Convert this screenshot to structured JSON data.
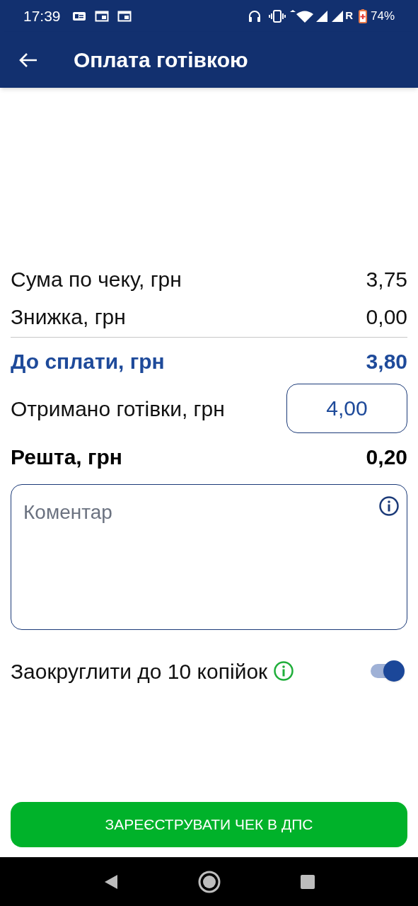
{
  "status_bar": {
    "time": "17:39",
    "roaming": "R",
    "battery": "74%"
  },
  "app_bar": {
    "title": "Оплата готівкою"
  },
  "summary": [
    {
      "kind": "plain",
      "label": "Сума по чеку, грн",
      "value": "3,75"
    },
    {
      "kind": "plain",
      "label": "Знижка, грн",
      "value": "0,00"
    },
    {
      "kind": "divider"
    },
    {
      "kind": "total",
      "label": "До сплати, грн",
      "value": "3,80"
    },
    {
      "kind": "input",
      "label": "Отримано готівки, грн",
      "value": "4,00"
    },
    {
      "kind": "change",
      "label": "Решта, грн",
      "value": "0,20"
    }
  ],
  "comment": {
    "placeholder": "Коментар"
  },
  "rounding": {
    "label": "Заокруглити до 10 копійок",
    "on": true
  },
  "submit_button": {
    "label": "ЗАРЕЄСТРУВАТИ ЧЕК В ДПС"
  }
}
